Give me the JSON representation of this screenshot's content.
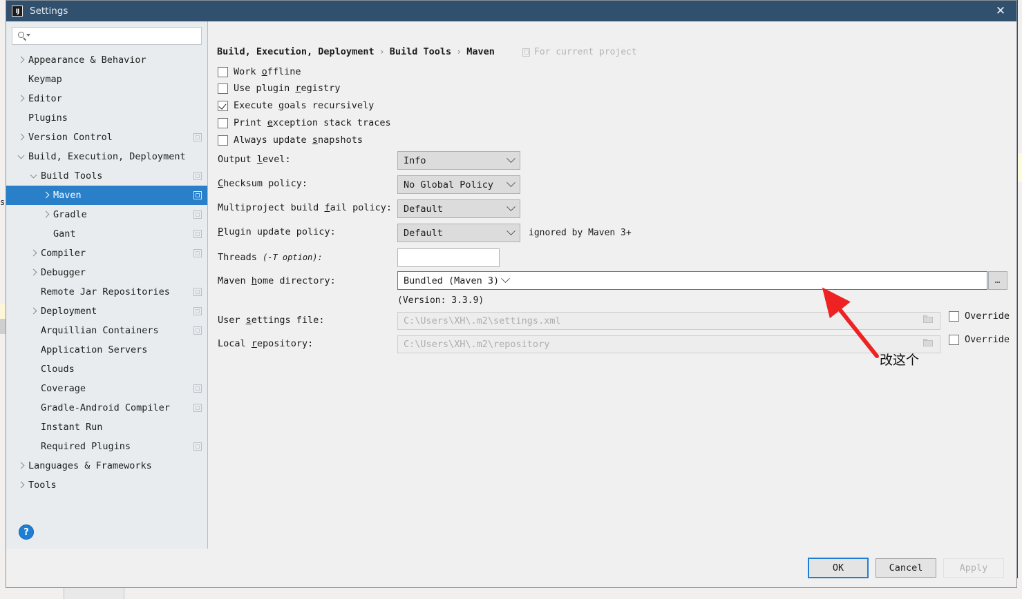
{
  "window": {
    "title": "Settings",
    "logo_icon": "intellij-idea-icon",
    "close_icon": "close-icon"
  },
  "search": {
    "value": "",
    "placeholder": "",
    "icon": "search-icon"
  },
  "sidebar": {
    "items": [
      {
        "label": "Appearance & Behavior",
        "indent": 0,
        "twisty": "right",
        "badge": false,
        "selected": false
      },
      {
        "label": "Keymap",
        "indent": 0,
        "twisty": "none",
        "badge": false,
        "selected": false
      },
      {
        "label": "Editor",
        "indent": 0,
        "twisty": "right",
        "badge": false,
        "selected": false
      },
      {
        "label": "Plugins",
        "indent": 0,
        "twisty": "none",
        "badge": false,
        "selected": false
      },
      {
        "label": "Version Control",
        "indent": 0,
        "twisty": "right",
        "badge": true,
        "selected": false
      },
      {
        "label": "Build, Execution, Deployment",
        "indent": 0,
        "twisty": "down",
        "badge": false,
        "selected": false
      },
      {
        "label": "Build Tools",
        "indent": 1,
        "twisty": "down",
        "badge": true,
        "selected": false
      },
      {
        "label": "Maven",
        "indent": 2,
        "twisty": "right",
        "badge": true,
        "selected": true
      },
      {
        "label": "Gradle",
        "indent": 2,
        "twisty": "right",
        "badge": true,
        "selected": false
      },
      {
        "label": "Gant",
        "indent": 2,
        "twisty": "none",
        "badge": true,
        "selected": false
      },
      {
        "label": "Compiler",
        "indent": 1,
        "twisty": "right",
        "badge": true,
        "selected": false
      },
      {
        "label": "Debugger",
        "indent": 1,
        "twisty": "right",
        "badge": false,
        "selected": false
      },
      {
        "label": "Remote Jar Repositories",
        "indent": 1,
        "twisty": "none",
        "badge": true,
        "selected": false
      },
      {
        "label": "Deployment",
        "indent": 1,
        "twisty": "right",
        "badge": true,
        "selected": false
      },
      {
        "label": "Arquillian Containers",
        "indent": 1,
        "twisty": "none",
        "badge": true,
        "selected": false
      },
      {
        "label": "Application Servers",
        "indent": 1,
        "twisty": "none",
        "badge": false,
        "selected": false
      },
      {
        "label": "Clouds",
        "indent": 1,
        "twisty": "none",
        "badge": false,
        "selected": false
      },
      {
        "label": "Coverage",
        "indent": 1,
        "twisty": "none",
        "badge": true,
        "selected": false
      },
      {
        "label": "Gradle-Android Compiler",
        "indent": 1,
        "twisty": "none",
        "badge": true,
        "selected": false
      },
      {
        "label": "Instant Run",
        "indent": 1,
        "twisty": "none",
        "badge": false,
        "selected": false
      },
      {
        "label": "Required Plugins",
        "indent": 1,
        "twisty": "none",
        "badge": true,
        "selected": false
      },
      {
        "label": "Languages & Frameworks",
        "indent": 0,
        "twisty": "right",
        "badge": false,
        "selected": false
      },
      {
        "label": "Tools",
        "indent": 0,
        "twisty": "right",
        "badge": false,
        "selected": false
      }
    ],
    "help_button": "?"
  },
  "main": {
    "breadcrumb": {
      "parts": [
        "Build, Execution, Deployment",
        "Build Tools",
        "Maven"
      ],
      "separator": "›"
    },
    "scope_label": "For current project",
    "scope_icon": "project-scope-icon",
    "checkboxes": [
      {
        "label_pre": "Work ",
        "mnemonic": "o",
        "label_post": "ffline",
        "checked": false
      },
      {
        "label_pre": "Use plugin ",
        "mnemonic": "r",
        "label_post": "egistry",
        "checked": false
      },
      {
        "label_pre": "Execute ",
        "mnemonic": "g",
        "label_post": "oals recursively",
        "checked": true
      },
      {
        "label_pre": "Print ",
        "mnemonic": "e",
        "label_post": "xception stack traces",
        "checked": false
      },
      {
        "label_pre": "Always update ",
        "mnemonic": "s",
        "label_post": "napshots",
        "checked": false
      }
    ],
    "fields": {
      "output_level": {
        "label_pre": "Output ",
        "mnemonic": "l",
        "label_post": "evel:",
        "value": "Info"
      },
      "checksum_policy": {
        "label_pre": "",
        "mnemonic": "C",
        "label_post": "hecksum policy:",
        "value": "No Global Policy"
      },
      "multiproject_fail_policy": {
        "label_pre": "Multiproject build ",
        "mnemonic": "f",
        "label_post": "ail policy:",
        "value": "Default"
      },
      "plugin_update_policy": {
        "label_pre": "",
        "mnemonic": "P",
        "label_post": "lugin update policy:",
        "value": "Default",
        "note": "ignored by Maven 3+"
      },
      "threads": {
        "label_pre": "Threads ",
        "label_italic": "(-T option):",
        "value": ""
      },
      "maven_home": {
        "label_pre": "Maven ",
        "mnemonic": "h",
        "label_post": "ome directory:",
        "value": "Bundled (Maven 3)",
        "version_note": "(Version: 3.3.9)",
        "browse_label": "…"
      },
      "user_settings_file": {
        "label_pre": "User ",
        "mnemonic": "s",
        "label_post": "ettings file:",
        "value": "C:\\Users\\XH\\.m2\\settings.xml",
        "override_label": "Override",
        "override_checked": false,
        "folder_icon": "folder-icon"
      },
      "local_repository": {
        "label_pre": "Local ",
        "mnemonic": "r",
        "label_post": "epository:",
        "value": "C:\\Users\\XH\\.m2\\repository",
        "override_label": "Override",
        "override_checked": false,
        "folder_icon": "folder-icon"
      }
    },
    "annotation": {
      "text": "改这个",
      "arrow_color": "#ee2222",
      "arrow_icon": "red-arrow-annotation"
    }
  },
  "footer": {
    "ok": "OK",
    "cancel": "Cancel",
    "apply": "Apply",
    "apply_disabled": true
  },
  "backdrop": {
    "left_text": "s"
  },
  "colors": {
    "titlebar": "#30506e",
    "sidebar_bg": "#e8ecee",
    "main_bg": "#f0f0f0",
    "selection": "#2a7fc9",
    "focus_border": "#3f7fc0",
    "annotation_red": "#ee2222"
  }
}
